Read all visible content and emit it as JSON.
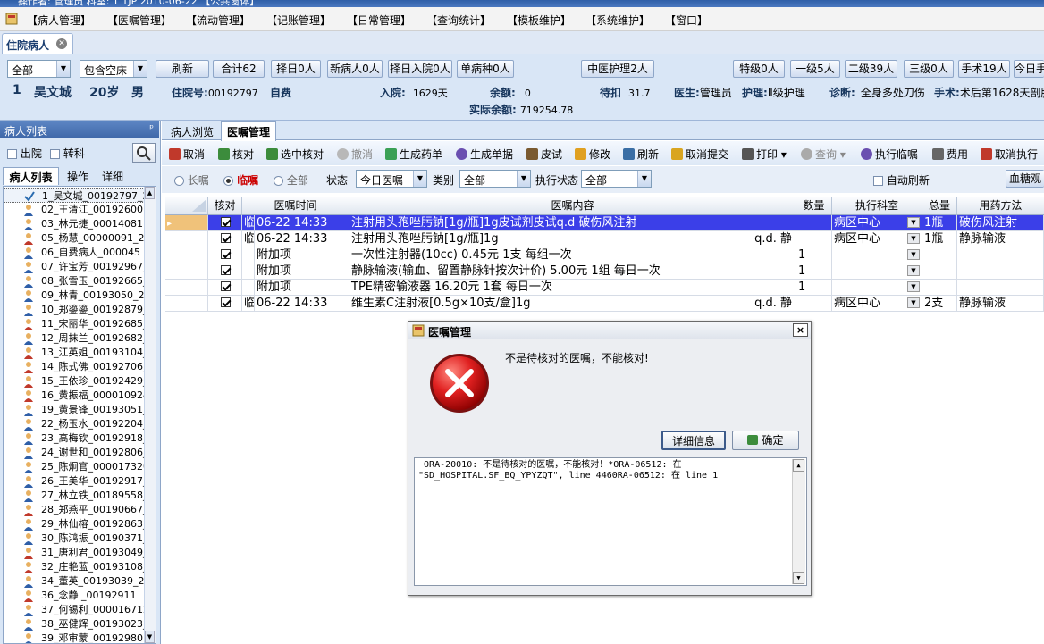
{
  "window": {
    "title_fragment": "操作者: 管理员  科室: 1 1JP  2010-06-22  【公共窗体】"
  },
  "menu": [
    "【病人管理】",
    "【医嘱管理】",
    "【流动管理】",
    "【记账管理】",
    "【日常管理】",
    "【查询统计】",
    "【模板维护】",
    "【系统维护】",
    "【窗口】"
  ],
  "doc_tab": {
    "label": "住院病人"
  },
  "filter": {
    "dept_select": "全部",
    "bed_select": "包含空床",
    "buttons": [
      "刷新",
      "合计62",
      "择日0人",
      "新病人0人",
      "择日入院0人",
      "单病种0人"
    ],
    "tcm_button": "中医护理2人",
    "right_buttons": [
      "特级0人",
      "一级5人",
      "二级39人",
      "三级0人",
      "手术19人",
      "今日手"
    ]
  },
  "patient": {
    "bed": "1",
    "name": "吴文城",
    "age": "20岁",
    "sex": "男",
    "inpatient_no_label": "住院号:",
    "inpatient_no": "00192797",
    "payment_type": "自费",
    "admit_label": "入院:",
    "admit_days": "1629天",
    "balance_label": "余额:",
    "balance": "0",
    "discount_label": "待扣",
    "discount": "31.7",
    "doctor_label": "医生:",
    "doctor": "管理员",
    "nursing_label": "护理:",
    "nursing": "Ⅱ级护理",
    "diagnosis_label": "诊断:",
    "diagnosis": "全身多处刀伤",
    "surgery_label": "手术:",
    "surgery": "术后第1628天剖腹",
    "actual_balance_label": "实际余额:",
    "actual_balance": "719254.78"
  },
  "left_panel": {
    "header": "病人列表",
    "pin": "ᵖ",
    "discharged_label": "出院",
    "transferred_label": "转科",
    "tabs": [
      "病人列表",
      "操作",
      "详细"
    ],
    "patients": [
      "1_吴文城_00192797_2",
      "02_王清江_00192600",
      "03_林元捷_00014081",
      "05_杨慧_00000091_20",
      "06_自费病人_000045",
      "07_许宝芳_00192967_",
      "08_张雪玉_00192665_",
      "09_林青_00193050_20",
      "10_郑鎏鎏_00192879_",
      "11_宋丽华_00192685_",
      "12_周抹兰_00192682_",
      "13_江英姐_00193104_",
      "14_陈式佛_00192706_",
      "15_王依珍_00192429_",
      "16_黄振福_000010924",
      "19_黄景锋_00193051_",
      "22_杨玉水_00192204_",
      "23_高梅钦_00192918_",
      "24_谢世和_00192806_",
      "25_陈炯官_000017320",
      "26_王美华_00192917_",
      "27_林立铁_00189558_",
      "28_郑燕平_00190667_",
      "29_林仙榕_00192863_",
      "30_陈鸿振_00190371_",
      "31_唐利君_00193049_",
      "32_庄艳蓝_00193108_",
      "34_董英_00193039_20",
      "36_念静 _00192911",
      "37_何锡利_000016712",
      "38_巫健辉_00193023_",
      "39_邓审蒙_00192980"
    ]
  },
  "right_panel": {
    "tabs": [
      "病人浏览",
      "医嘱管理"
    ],
    "toolbar": [
      "取消",
      "核对",
      "选中核对",
      "撤消",
      "生成药单",
      "生成单据",
      "皮试",
      "修改",
      "刷新",
      "取消提交",
      "打印",
      "查询",
      "执行临嘱",
      "费用",
      "取消执行"
    ],
    "opts": {
      "long": "长嘱",
      "temp": "临嘱",
      "all": "全部",
      "status_label": "状态",
      "status": "今日医嘱",
      "type_label": "类别",
      "type": "全部",
      "exec_label": "执行状态",
      "exec": "全部",
      "auto_refresh": "自动刷新",
      "blood_btn": "血糖观"
    },
    "grid_headers": [
      "核对",
      "医嘱时间",
      "医嘱内容",
      "数量",
      "执行科室",
      "总量",
      "用药方法"
    ],
    "rows": [
      {
        "tag": "临",
        "time": "06-22 14:33",
        "content": "注射用头孢唑肟钠[1g/瓶]1g皮试剂皮试q.d  破伤风注射",
        "freq": "",
        "qty": "",
        "dept": "病区中心",
        "total": "1瓶",
        "method": "破伤风注射"
      },
      {
        "tag": "临",
        "time": "06-22 14:33",
        "content": "注射用头孢唑肟钠[1g/瓶]1g",
        "freq": "q.d. 静",
        "qty": "",
        "dept": "病区中心",
        "total": "1瓶",
        "method": "静脉输液"
      },
      {
        "tag": "",
        "time": "附加项",
        "content": "一次性注射器(10cc)      0.45元 1支  每组一次",
        "freq": "",
        "qty": "1",
        "dept": "",
        "total": "",
        "method": ""
      },
      {
        "tag": "",
        "time": "附加项",
        "content": "静脉输液(输血、留置静脉针按次计价)      5.00元 1组  每日一次",
        "freq": "",
        "qty": "1",
        "dept": "",
        "total": "",
        "method": ""
      },
      {
        "tag": "",
        "time": "附加项",
        "content": "TPE精密输液器      16.20元 1套  每日一次",
        "freq": "",
        "qty": "1",
        "dept": "",
        "total": "",
        "method": ""
      },
      {
        "tag": "临",
        "time": "06-22 14:33",
        "content": "维生素C注射液[0.5g×10支/盒]1g",
        "freq": "q.d. 静",
        "qty": "",
        "dept": "病区中心",
        "total": "2支",
        "method": "静脉输液"
      }
    ]
  },
  "dialog": {
    "title": "医嘱管理",
    "close": "×",
    "message": "不是待核对的医嘱，不能核对!",
    "details_button": "详细信息",
    "ok_button": "确定",
    "detail_text": " ORA-20010: 不是待核对的医嘱，不能核对！*ORA-06512: 在\n\"SD_HOSPITAL.SF_BQ_YPYZQT\", line 4460RA-06512: 在 line 1"
  }
}
